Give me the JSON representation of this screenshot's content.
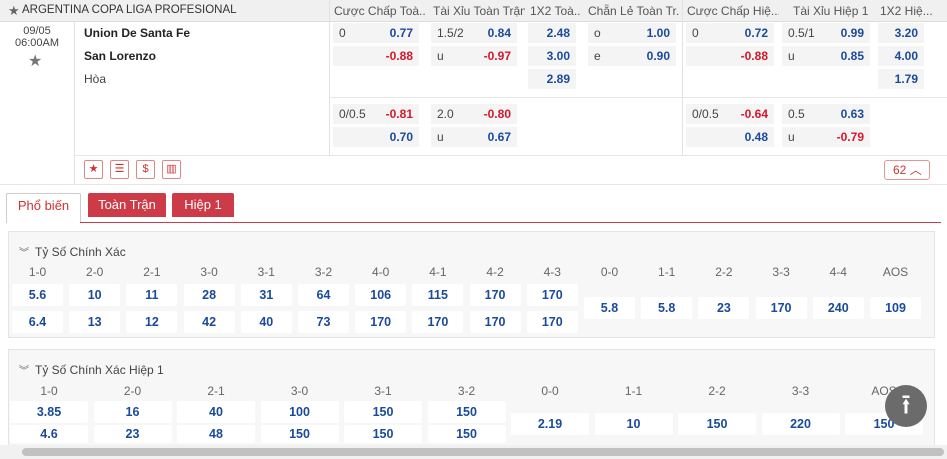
{
  "header": {
    "league": "ARGENTINA COPA LIGA PROFESIONAL",
    "cols": [
      "Cược Chấp Toà...",
      "Tài Xỉu Toàn Trận",
      "1X2 Toà...",
      "Chẵn Lẻ Toàn Tr...",
      "Cược Chấp Hiệ...",
      "Tài Xỉu Hiệp 1",
      "1X2 Hiệ..."
    ]
  },
  "match": {
    "date": "09/05",
    "time": "06:00AM",
    "home": "Union De Santa Fe",
    "away": "San Lorenzo",
    "draw": "Hòa"
  },
  "odds": {
    "ah_ft_1": {
      "h1": "0",
      "o1": "0.77",
      "h2": "",
      "o2": "-0.88"
    },
    "ou_ft_1": {
      "h1": "1.5/2",
      "o1": "0.84",
      "h2": "u",
      "o2": "-0.97"
    },
    "x12_ft": {
      "o1": "2.48",
      "o2": "3.00",
      "o3": "2.89"
    },
    "oe_ft": {
      "h1": "o",
      "o1": "1.00",
      "h2": "e",
      "o2": "0.90"
    },
    "ah_h1_1": {
      "h1": "0",
      "o1": "0.72",
      "h2": "",
      "o2": "-0.88"
    },
    "ou_h1_1": {
      "h1": "0.5/1",
      "o1": "0.99",
      "h2": "u",
      "o2": "0.85"
    },
    "x12_h1": {
      "o1": "3.20",
      "o2": "4.00",
      "o3": "1.79"
    },
    "ah_ft_2": {
      "h1": "0/0.5",
      "o1": "-0.81",
      "h2": "",
      "o2": "0.70"
    },
    "ou_ft_2": {
      "h1": "2.0",
      "o1": "-0.80",
      "h2": "u",
      "o2": "0.67"
    },
    "ah_h1_2": {
      "h1": "0/0.5",
      "o1": "-0.64",
      "h2": "",
      "o2": "0.48"
    },
    "ou_h1_2": {
      "h1": "0.5",
      "o1": "0.63",
      "h2": "u",
      "o2": "-0.79"
    }
  },
  "tools": {
    "more_count": "62"
  },
  "tabs": [
    "Phổ biến",
    "Toàn Trận",
    "Hiệp 1"
  ],
  "correct_score": {
    "title": "Tỷ Số Chính Xác",
    "labels": [
      "1-0",
      "2-0",
      "2-1",
      "3-0",
      "3-1",
      "3-2",
      "4-0",
      "4-1",
      "4-2",
      "4-3",
      "0-0",
      "1-1",
      "2-2",
      "3-3",
      "4-4",
      "AOS"
    ],
    "home": [
      "5.6",
      "10",
      "11",
      "28",
      "31",
      "64",
      "106",
      "115",
      "170",
      "170"
    ],
    "away": [
      "6.4",
      "13",
      "12",
      "42",
      "40",
      "73",
      "170",
      "170",
      "170",
      "170"
    ],
    "draw": [
      "5.8",
      "5.8",
      "23",
      "170",
      "240",
      "109"
    ]
  },
  "correct_score_h1": {
    "title": "Tỷ Số Chính Xác Hiệp 1",
    "labels": [
      "1-0",
      "2-0",
      "2-1",
      "3-0",
      "3-1",
      "3-2",
      "0-0",
      "1-1",
      "2-2",
      "3-3",
      "AOS"
    ],
    "home": [
      "3.85",
      "16",
      "40",
      "100",
      "150",
      "150"
    ],
    "away": [
      "4.6",
      "23",
      "48",
      "150",
      "150",
      "150"
    ],
    "draw": [
      "2.19",
      "10",
      "150",
      "220",
      "150"
    ]
  }
}
